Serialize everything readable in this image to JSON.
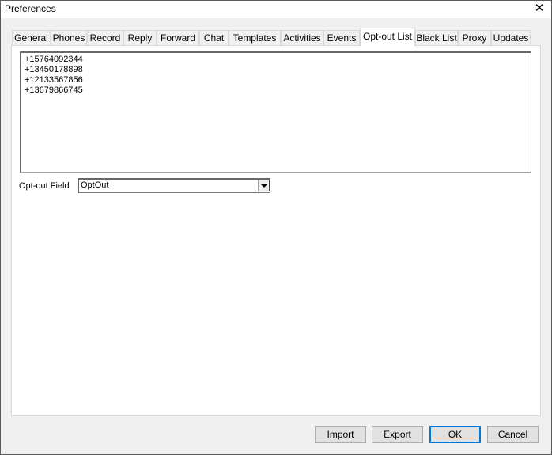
{
  "window": {
    "title": "Preferences"
  },
  "tabs": [
    {
      "label": "General",
      "active": false
    },
    {
      "label": "Phones",
      "active": false
    },
    {
      "label": "Record",
      "active": false
    },
    {
      "label": "Reply",
      "active": false
    },
    {
      "label": "Forward",
      "active": false
    },
    {
      "label": "Chat",
      "active": false
    },
    {
      "label": "Templates",
      "active": false
    },
    {
      "label": "Activities",
      "active": false
    },
    {
      "label": "Events",
      "active": false
    },
    {
      "label": "Opt-out List",
      "active": true
    },
    {
      "label": "Black List",
      "active": false
    },
    {
      "label": "Proxy",
      "active": false
    },
    {
      "label": "Updates",
      "active": false
    }
  ],
  "optout_list": {
    "numbers": [
      "+15764092344",
      "+13450178898",
      "+12133567856",
      "+13679866745"
    ]
  },
  "optout_field": {
    "label": "Opt-out Field",
    "value": "OptOut"
  },
  "buttons": {
    "import": "Import",
    "export": "Export",
    "ok": "OK",
    "cancel": "Cancel"
  },
  "icons": {
    "close": "close-icon",
    "dropdown": "chevron-down-icon"
  }
}
